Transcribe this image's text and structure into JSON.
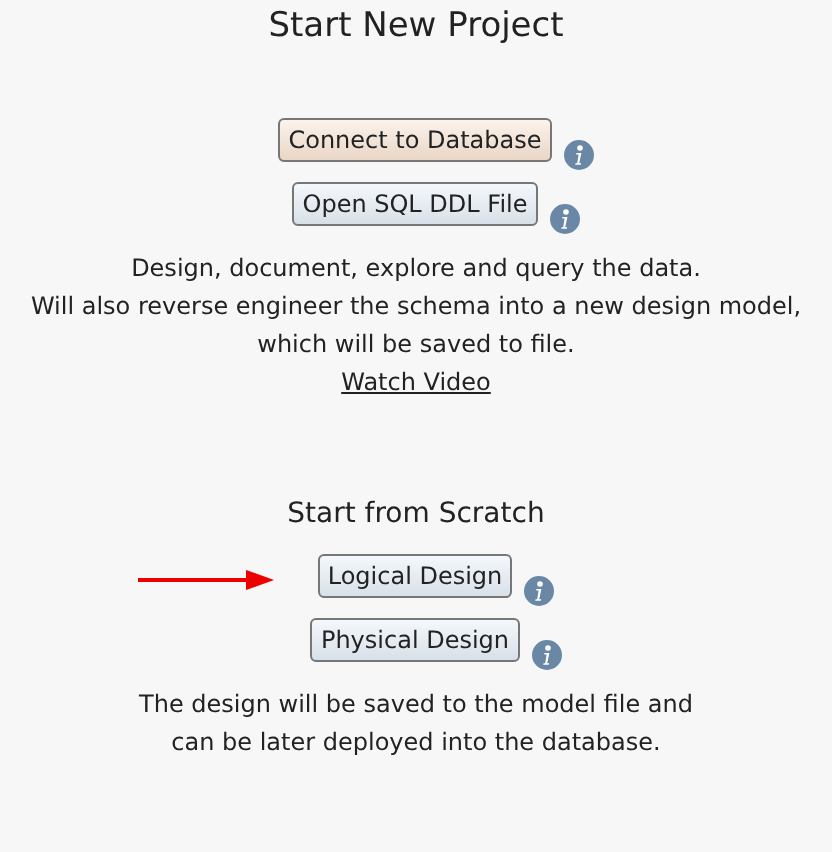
{
  "title": "Start New Project",
  "sections": [
    {
      "buttons": [
        {
          "label": "Connect to Database",
          "highlighted": true,
          "arrow": false
        },
        {
          "label": "Open SQL DDL File",
          "highlighted": false,
          "arrow": false
        }
      ],
      "description": [
        "Design, document, explore and query the data.",
        "Will also reverse engineer the schema into a new design model,",
        "which will be saved to file."
      ],
      "link": "Watch Video"
    },
    {
      "heading": "Start from Scratch",
      "buttons": [
        {
          "label": "Logical Design",
          "highlighted": false,
          "arrow": true
        },
        {
          "label": "Physical Design",
          "highlighted": false,
          "arrow": false
        }
      ],
      "description": [
        "The design will be saved to the model file and",
        "can be later deployed into the database."
      ]
    }
  ]
}
